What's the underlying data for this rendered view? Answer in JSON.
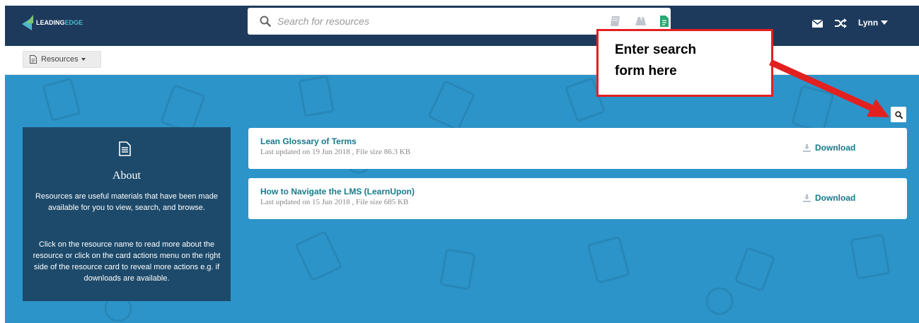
{
  "app": {
    "logo": {
      "text_primary": "LEADING",
      "text_accent": "EDGE"
    }
  },
  "header": {
    "search": {
      "placeholder": "Search for resources",
      "value": ""
    },
    "type_filters": [
      "book-icon",
      "link-icon",
      "document-icon"
    ],
    "user_name": "Lynn"
  },
  "subbar": {
    "resources_label": "Resources"
  },
  "about": {
    "title": "About",
    "description_1": "Resources are useful materials that have been made available for you to view, search, and browse.",
    "description_2": "Click on the resource name to read more about the resource or click on the card actions menu on the right side of the resource card to reveal more actions e.g. if downloads are available."
  },
  "resources": [
    {
      "title": "Lean Glossary of Terms",
      "meta": "Last updated on 19 Jun 2018 , File size 86.3 KB",
      "action": "Download"
    },
    {
      "title": "How to Navigate the LMS (LearnUpon)",
      "meta": "Last updated on 15 Jun 2018 , File size 685 KB",
      "action": "Download"
    }
  ],
  "callout": {
    "text_line_1": "Enter search",
    "text_line_2": "form here"
  },
  "colors": {
    "topbar": "#1d3a5c",
    "main_bg": "#2c94c9",
    "about_bg": "#1d4a6b",
    "link": "#167a8b",
    "callout_border": "#e32020"
  }
}
